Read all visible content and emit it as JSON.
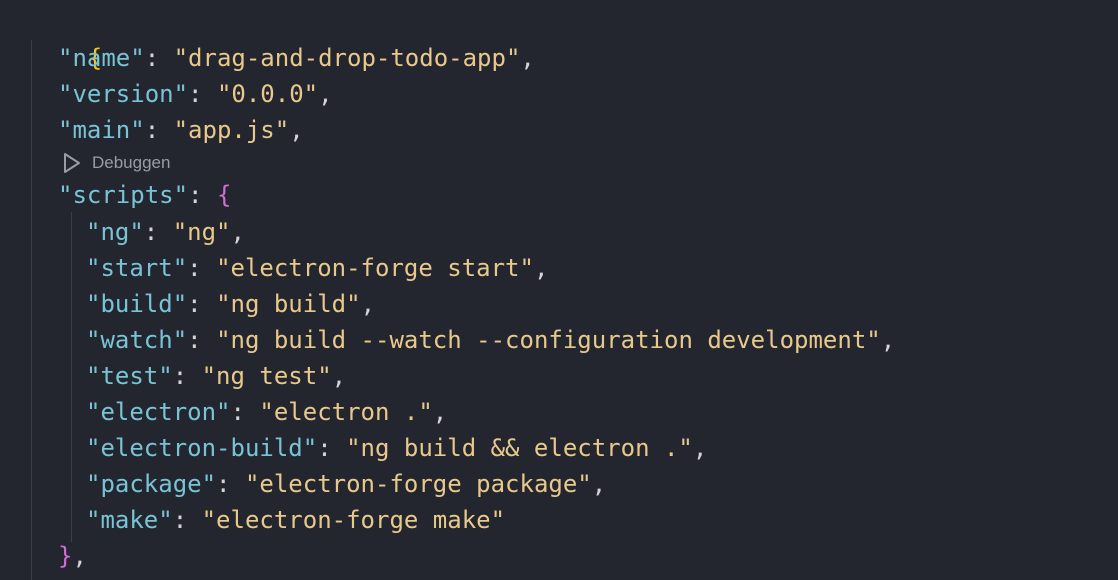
{
  "editor": {
    "colors": {
      "background": "#24262f",
      "key": "#78c4d4",
      "string": "#e8c98c",
      "punctuation": "#d4d4d4",
      "bracket_outer": "#f5c518",
      "bracket_inner": "#d36cd4",
      "codelens": "#9a9ca3"
    },
    "open_brace": "{",
    "top_fields": [
      {
        "key": "\"name\"",
        "value": "\"drag-and-drop-todo-app\"",
        "sep": ": ",
        "end": ","
      },
      {
        "key": "\"version\"",
        "value": "\"0.0.0\"",
        "sep": ": ",
        "end": ","
      },
      {
        "key": "\"main\"",
        "value": "\"app.js\"",
        "sep": ": ",
        "end": ","
      }
    ],
    "codelens": {
      "icon": "play-icon",
      "label": "Debuggen"
    },
    "scripts": {
      "key": "\"scripts\"",
      "sep": ": ",
      "open": "{",
      "entries": [
        {
          "key": "\"ng\"",
          "value": "\"ng\"",
          "sep": ": ",
          "end": ","
        },
        {
          "key": "\"start\"",
          "value": "\"electron-forge start\"",
          "sep": ": ",
          "end": ","
        },
        {
          "key": "\"build\"",
          "value": "\"ng build\"",
          "sep": ": ",
          "end": ","
        },
        {
          "key": "\"watch\"",
          "value": "\"ng build --watch --configuration development\"",
          "sep": ": ",
          "end": ","
        },
        {
          "key": "\"test\"",
          "value": "\"ng test\"",
          "sep": ": ",
          "end": ","
        },
        {
          "key": "\"electron\"",
          "value": "\"electron .\"",
          "sep": ": ",
          "end": ","
        },
        {
          "key": "\"electron-build\"",
          "value": "\"ng build && electron .\"",
          "sep": ": ",
          "end": ","
        },
        {
          "key": "\"package\"",
          "value": "\"electron-forge package\"",
          "sep": ": ",
          "end": ","
        },
        {
          "key": "\"make\"",
          "value": "\"electron-forge make\"",
          "sep": ": ",
          "end": ""
        }
      ],
      "close": "}",
      "close_end": ","
    }
  }
}
